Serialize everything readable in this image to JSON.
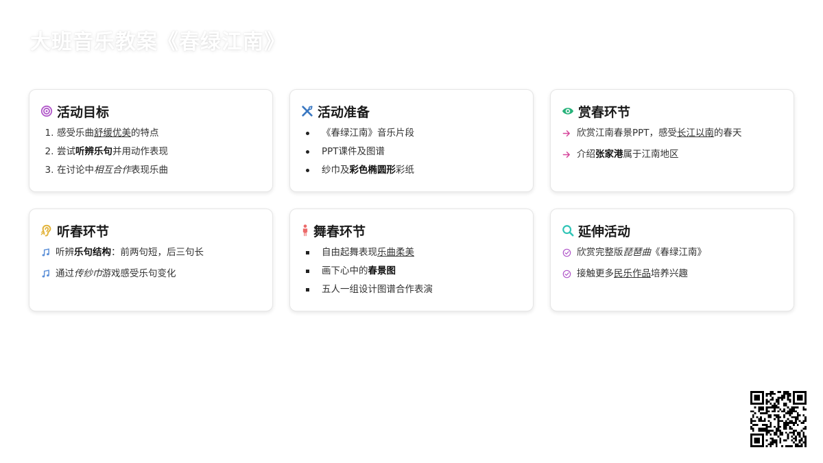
{
  "page_title": "大班音乐教案《春绿江南》",
  "colors": {
    "target": "#b056c9",
    "tools": "#3a78c2",
    "eye": "#27b27a",
    "ear": "#e2b33a",
    "person": "#ec6b6b",
    "search": "#2fc4b6",
    "arrow": "#d6469b",
    "music": "#5b8fd8",
    "check": "#b056c9"
  },
  "cards": {
    "goals": {
      "title": "活动目标",
      "icon": "target-icon",
      "items": [
        {
          "marker": "1.",
          "parts": [
            {
              "t": "感受乐曲"
            },
            {
              "t": "舒缓优美",
              "s": "u"
            },
            {
              "t": "的特点"
            }
          ]
        },
        {
          "marker": "2.",
          "parts": [
            {
              "t": "尝试"
            },
            {
              "t": "听辨乐句",
              "s": "b"
            },
            {
              "t": "并用动作表现"
            }
          ]
        },
        {
          "marker": "3.",
          "parts": [
            {
              "t": "在讨论中"
            },
            {
              "t": "相互合作",
              "s": "i"
            },
            {
              "t": "表现乐曲"
            }
          ]
        }
      ]
    },
    "prep": {
      "title": "活动准备",
      "icon": "tools-icon",
      "items": [
        {
          "parts": [
            {
              "t": "《春绿江南》音乐片段"
            }
          ]
        },
        {
          "parts": [
            {
              "t": "PPT课件及图谱"
            }
          ]
        },
        {
          "parts": [
            {
              "t": "纱巾及"
            },
            {
              "t": "彩色椭圆形",
              "s": "b"
            },
            {
              "t": "彩纸"
            }
          ]
        }
      ]
    },
    "appreciate": {
      "title": "赏春环节",
      "icon": "eye-icon",
      "items": [
        {
          "icon": "arrow-right-icon",
          "parts": [
            {
              "t": "欣赏江南春景PPT，感受"
            },
            {
              "t": "长江以南",
              "s": "u"
            },
            {
              "t": "的春天"
            }
          ]
        },
        {
          "icon": "arrow-right-icon",
          "parts": [
            {
              "t": "介绍"
            },
            {
              "t": "张家港",
              "s": "b"
            },
            {
              "t": "属于江南地区"
            }
          ]
        }
      ]
    },
    "listen": {
      "title": "听春环节",
      "icon": "ear-icon",
      "items": [
        {
          "icon": "music-note-icon",
          "parts": [
            {
              "t": "听辨"
            },
            {
              "t": "乐句结构",
              "s": "b"
            },
            {
              "t": "：前两句短，后三句长"
            }
          ]
        },
        {
          "icon": "music-note-icon",
          "parts": [
            {
              "t": "通过"
            },
            {
              "t": "传纱巾",
              "s": "i"
            },
            {
              "t": "游戏感受乐句变化"
            }
          ]
        }
      ]
    },
    "dance": {
      "title": "舞春环节",
      "icon": "person-icon",
      "items": [
        {
          "parts": [
            {
              "t": "自由起舞表现"
            },
            {
              "t": "乐曲柔美",
              "s": "u"
            }
          ]
        },
        {
          "parts": [
            {
              "t": "画下心中的"
            },
            {
              "t": "春景图",
              "s": "b"
            }
          ]
        },
        {
          "parts": [
            {
              "t": "五人一组设计图谱合作表演"
            }
          ]
        }
      ]
    },
    "extend": {
      "title": "延伸活动",
      "icon": "search-icon",
      "items": [
        {
          "icon": "check-circle-icon",
          "parts": [
            {
              "t": "欣赏完整版"
            },
            {
              "t": "琵琶曲",
              "s": "i"
            },
            {
              "t": "《春绿江南》"
            }
          ]
        },
        {
          "icon": "check-circle-icon",
          "parts": [
            {
              "t": "接触更多"
            },
            {
              "t": "民乐作品",
              "s": "u"
            },
            {
              "t": "培养兴趣"
            }
          ]
        }
      ]
    }
  },
  "qr_code": "qr-code-icon"
}
